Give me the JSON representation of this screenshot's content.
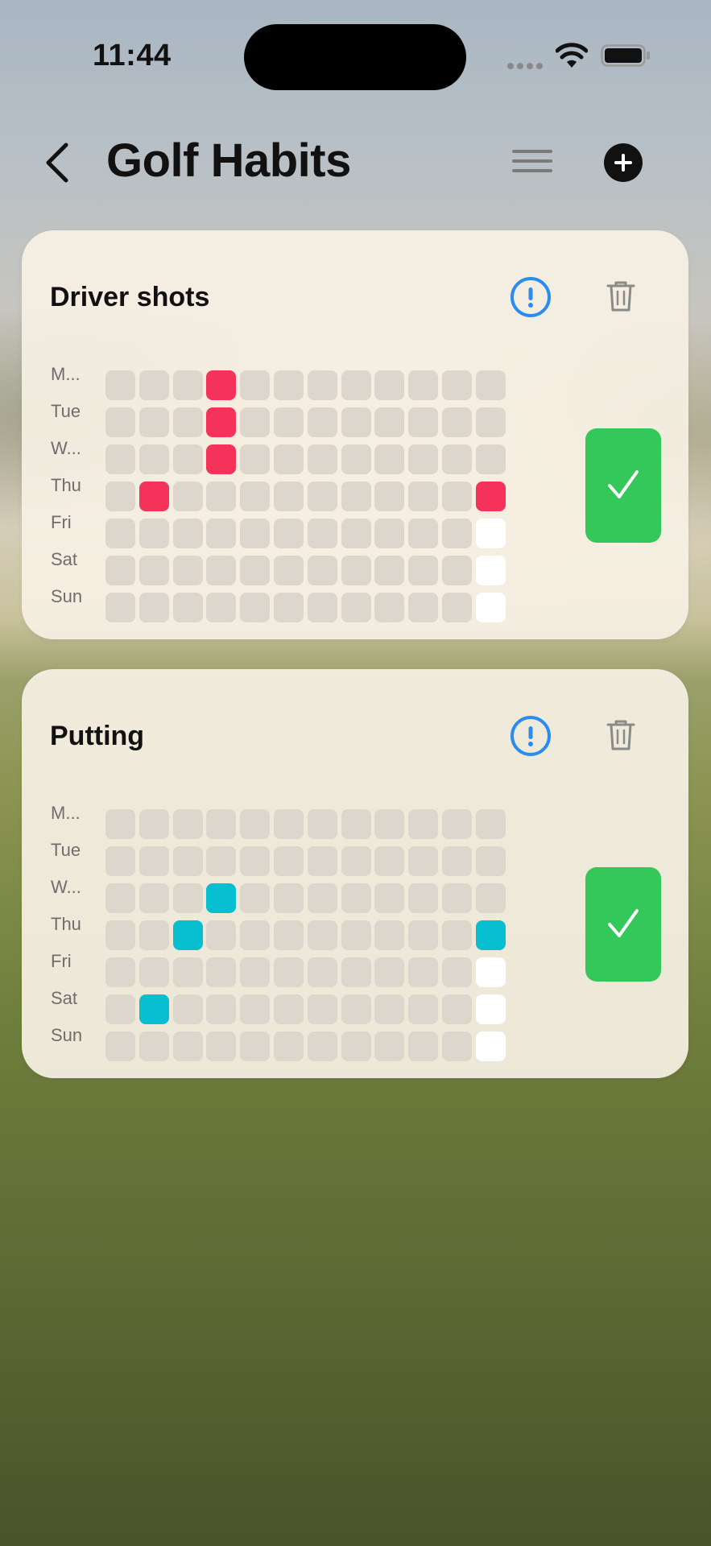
{
  "status_bar": {
    "time": "11:44"
  },
  "nav": {
    "title": "Golf Habits"
  },
  "day_labels": [
    "M...",
    "Tue",
    "W...",
    "Thu",
    "Fri",
    "Sat",
    "Sun"
  ],
  "habits": [
    {
      "name": "Driver shots",
      "color": "#f5325a",
      "marked": [
        [
          0,
          3
        ],
        [
          1,
          3
        ],
        [
          2,
          3
        ],
        [
          3,
          1
        ],
        [
          3,
          11
        ]
      ],
      "today": [
        [
          4,
          11
        ],
        [
          5,
          11
        ],
        [
          6,
          11
        ]
      ]
    },
    {
      "name": "Putting",
      "color": "#08bfd2",
      "marked": [
        [
          2,
          3
        ],
        [
          3,
          2
        ],
        [
          3,
          11
        ],
        [
          5,
          1
        ]
      ],
      "today": [
        [
          4,
          11
        ],
        [
          5,
          11
        ],
        [
          6,
          11
        ]
      ]
    }
  ],
  "colors": {
    "empty_cell": "#dcd6cc",
    "today_cell": "#ffffff",
    "check_button": "#34c759",
    "info_icon": "#2a8cf0"
  },
  "icons": {
    "back": "chevron-left-icon",
    "menu": "hamburger-icon",
    "add": "plus-circle-icon",
    "info": "exclamation-circle-icon",
    "delete": "trash-icon",
    "check": "checkmark-icon"
  }
}
